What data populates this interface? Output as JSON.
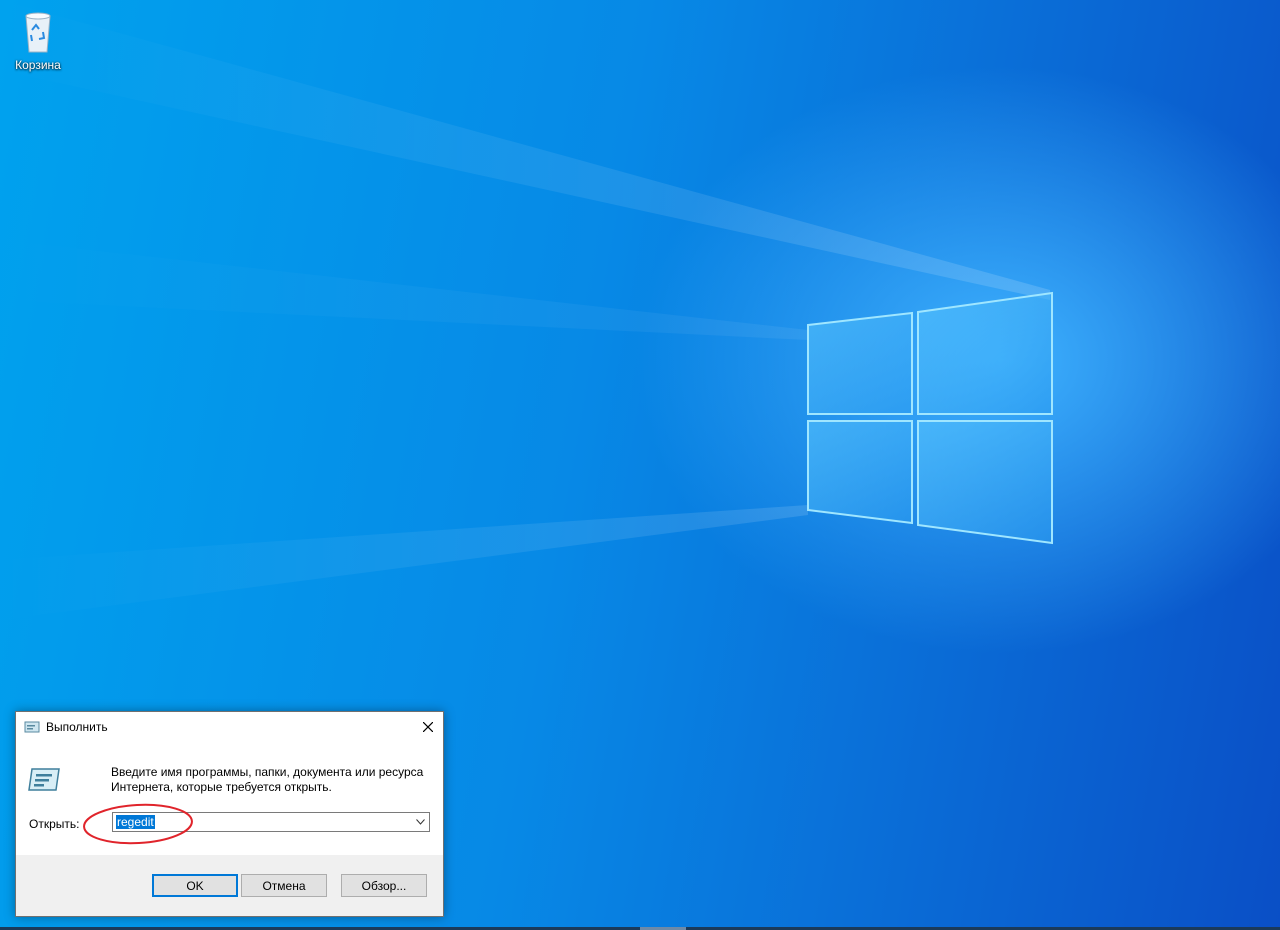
{
  "desktop": {
    "icons": [
      {
        "label": "Корзина",
        "icon": "recycle-bin-icon"
      }
    ]
  },
  "run_dialog": {
    "title": "Выполнить",
    "description": "Введите имя программы, папки, документа или ресурса Интернета, которые требуется открыть.",
    "open_label": "Открыть:",
    "input_value": "regedit",
    "buttons": {
      "ok": "OK",
      "cancel": "Отмена",
      "browse": "Обзор..."
    },
    "annotation_color": "#e0242b"
  },
  "colors": {
    "wallpaper_accent": "#0a78e0",
    "selection": "#0078d7",
    "default_button_border": "#0078d7"
  }
}
